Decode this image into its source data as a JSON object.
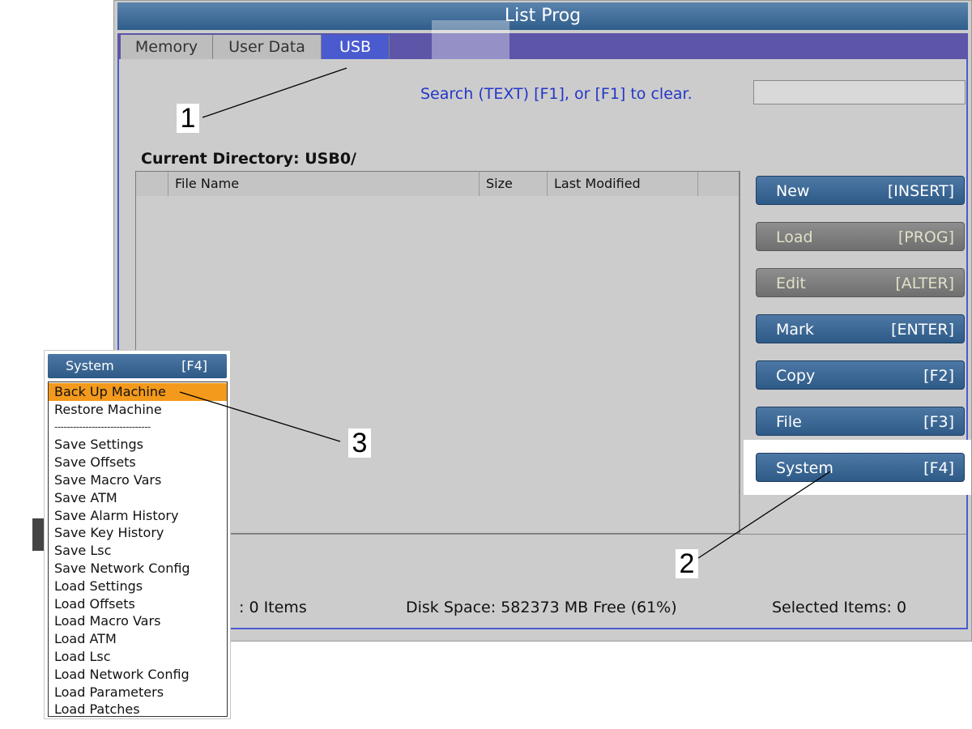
{
  "window": {
    "title": "List Prog"
  },
  "tabs": [
    {
      "label": "Memory"
    },
    {
      "label": "User Data"
    },
    {
      "label": "USB"
    }
  ],
  "search": {
    "label": "Search (TEXT) [F1], or [F1] to clear.",
    "value": ""
  },
  "current_directory": "Current Directory: USB0/",
  "table": {
    "columns": [
      "File Name",
      "Size",
      "Last Modified"
    ],
    "rows": []
  },
  "side_buttons": [
    {
      "label": "New",
      "key": "[INSERT]",
      "enabled": true
    },
    {
      "label": "Load",
      "key": "[PROG]",
      "enabled": false
    },
    {
      "label": "Edit",
      "key": "[ALTER]",
      "enabled": false
    },
    {
      "label": "Mark",
      "key": "[ENTER]",
      "enabled": true
    },
    {
      "label": "Copy",
      "key": "[F2]",
      "enabled": true
    },
    {
      "label": "File",
      "key": "[F3]",
      "enabled": true
    },
    {
      "label": "System",
      "key": "[F4]",
      "enabled": true
    }
  ],
  "status": {
    "items": ": 0 Items",
    "disk_space": "Disk Space: 582373 MB Free (61%)",
    "selected": "Selected Items: 0"
  },
  "dropdown": {
    "header_label": "System",
    "header_key": "[F4]",
    "items": [
      "Back Up Machine",
      "Restore Machine",
      "-------------------------------",
      "Save Settings",
      "Save Offsets",
      "Save Macro Vars",
      "Save ATM",
      "Save Alarm History",
      "Save Key History",
      "Save Lsc",
      "Save Network Config",
      "Load Settings",
      "Load Offsets",
      "Load Macro Vars",
      "Load ATM",
      "Load Lsc",
      "Load Network Config",
      "Load Parameters",
      "Load Patches"
    ]
  },
  "callouts": [
    "1",
    "2",
    "3"
  ],
  "colors": {
    "accent_blue": "#4a5bd0",
    "button_blue": "#3a6595",
    "highlight_orange": "#f39a1c",
    "search_text": "#2436c8"
  }
}
